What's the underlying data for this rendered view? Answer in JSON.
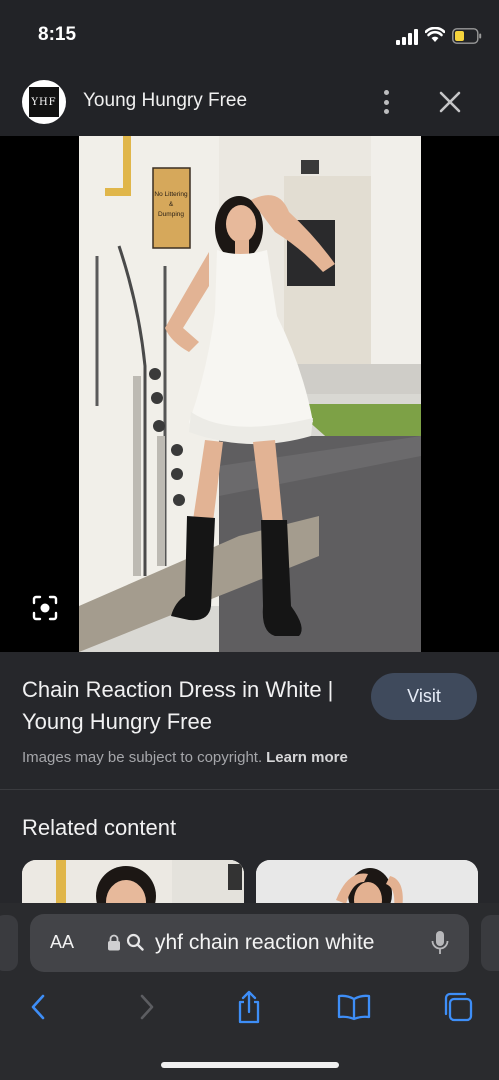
{
  "status_bar": {
    "time": "8:15",
    "icons": [
      "signal-icon",
      "wifi-icon",
      "battery-icon"
    ],
    "battery_color": "#f5d33c"
  },
  "header": {
    "logo_text": "YHF",
    "site_name": "Young Hungry Free",
    "icons": [
      "more-vertical-icon",
      "close-icon"
    ]
  },
  "image": {
    "alt": "Chain Reaction Dress in White",
    "sign_text": "No Littering & Dumping",
    "lens_icon": "visual-search-icon"
  },
  "result": {
    "title": "Chain Reaction Dress in White | Young Hungry Free",
    "visit_label": "Visit",
    "copyright_text": "Images may be subject to copyright.",
    "learn_more_label": "Learn more"
  },
  "related": {
    "heading": "Related content"
  },
  "browser": {
    "aa_label": "AA",
    "url_text": "yhf chain reaction white",
    "icons": [
      "lock-icon",
      "search-icon",
      "microphone-icon",
      "back-icon",
      "forward-icon",
      "share-icon",
      "bookmarks-icon",
      "tabs-icon"
    ],
    "accent": "#3e8ef7"
  }
}
